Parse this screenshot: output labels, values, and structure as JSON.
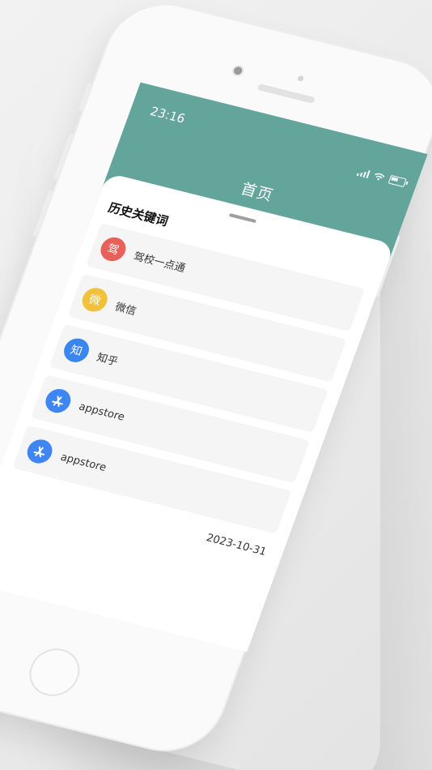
{
  "status_bar": {
    "time": "23:16"
  },
  "header": {
    "title": "首页",
    "color": "#63a49b"
  },
  "section": {
    "title": "历史关键词"
  },
  "history": {
    "items": [
      {
        "icon_text": "驾",
        "icon_color": "#e8605a",
        "label": "驾校一点通"
      },
      {
        "icon_text": "微",
        "icon_color": "#f2c13a",
        "label": "微信"
      },
      {
        "icon_text": "知",
        "icon_color": "#3a86f0",
        "label": "知乎"
      },
      {
        "icon_text": "",
        "icon_name": "app-store-icon",
        "icon_color": "#3f86f5",
        "label": "appstore"
      },
      {
        "icon_text": "",
        "icon_name": "app-store-icon",
        "icon_color": "#3f86f5",
        "label": "appstore"
      }
    ],
    "date": "2023-10-31"
  }
}
